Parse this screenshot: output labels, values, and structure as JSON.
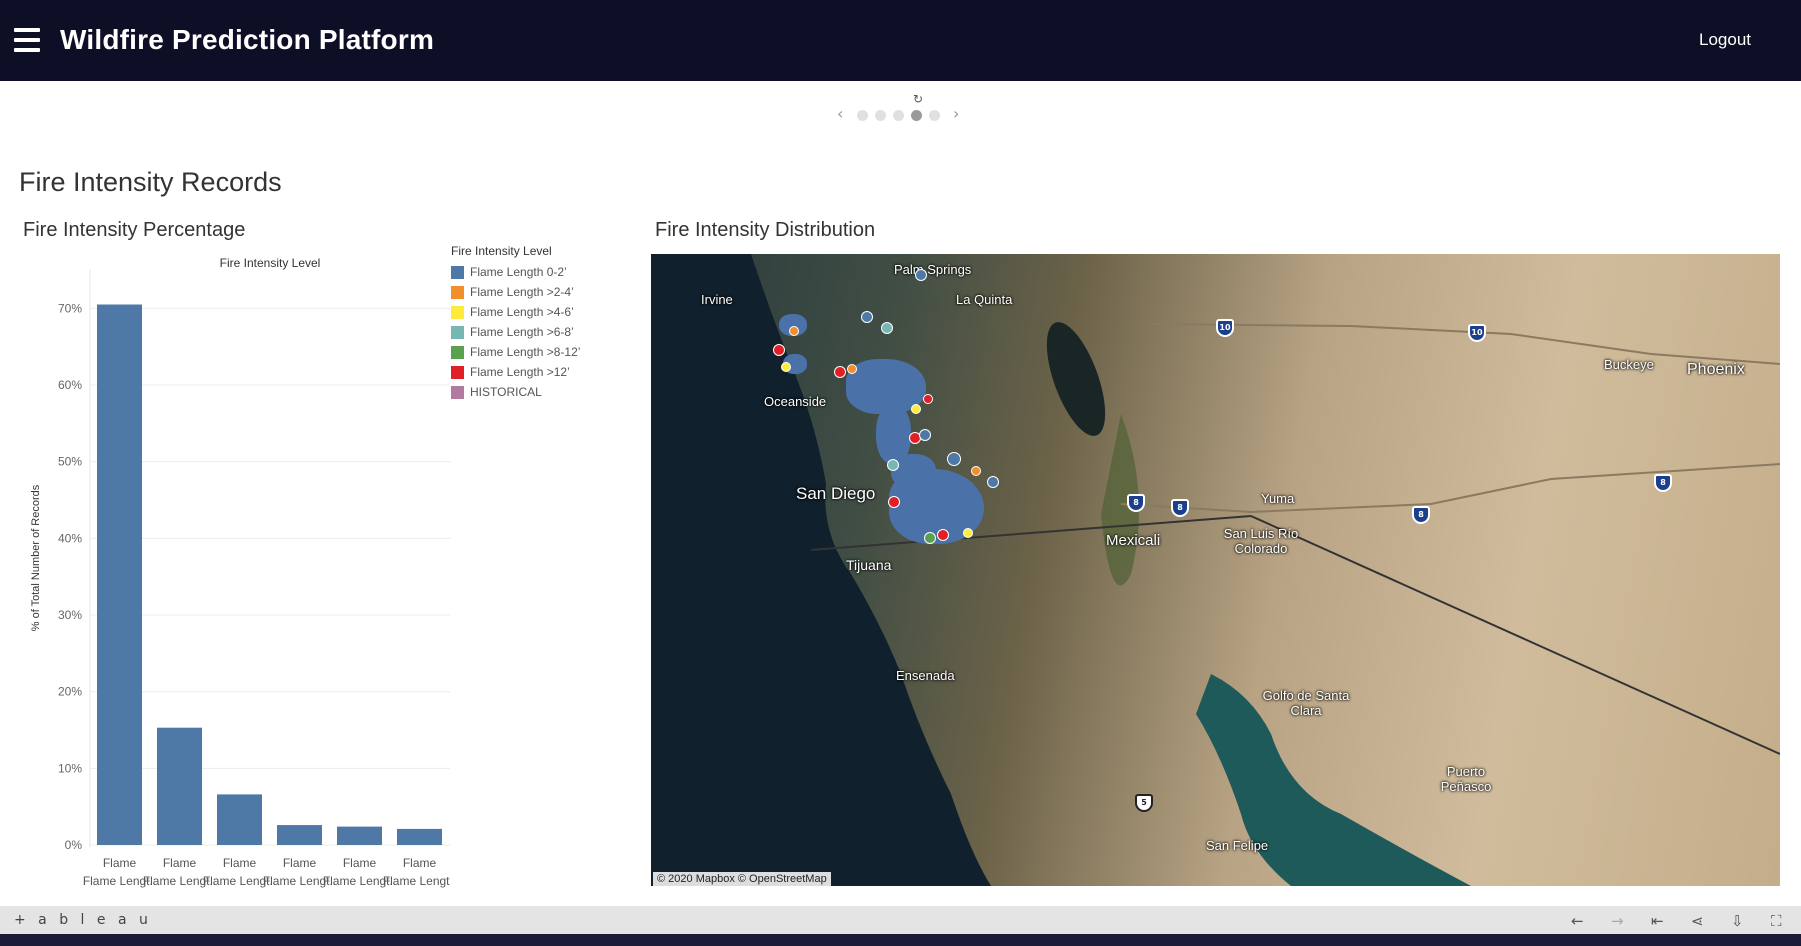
{
  "header": {
    "title": "Wildfire Prediction Platform",
    "logout_label": "Logout",
    "menu_icon": "hamburger-icon"
  },
  "carousel": {
    "prev": "‹",
    "next": "›",
    "refresh": "↻",
    "dots": 5,
    "active_index": 3
  },
  "dashboard": {
    "title": "Fire Intensity Records",
    "percentage_title": "Fire Intensity Percentage",
    "distribution_title": "Fire Intensity Distribution"
  },
  "legend": {
    "title": "Fire Intensity Level",
    "items": [
      {
        "label": "Flame Length 0-2’",
        "color": "#4e79a7"
      },
      {
        "label": "Flame Length >2-4’",
        "color": "#f28e2b"
      },
      {
        "label": "Flame Length >4-6’",
        "color": "#ffeb3b"
      },
      {
        "label": "Flame Length >6-8’",
        "color": "#76b7b2"
      },
      {
        "label": "Flame Length >8-12’",
        "color": "#59a14f"
      },
      {
        "label": "Flame Length >12’",
        "color": "#e01f26"
      },
      {
        "label": "HISTORICAL",
        "color": "#b07aa1"
      }
    ]
  },
  "chart_data": {
    "type": "bar",
    "title": "Fire Intensity Level",
    "ylabel": "% of Total Number of Records",
    "xlabel": "",
    "categories": [
      "Flame Lengt..",
      "Flame Lengt..",
      "Flame Lengt..",
      "Flame Lengt..",
      "Flame Lengt..",
      "Flame Lengt.."
    ],
    "category_line1": "Flame",
    "values": [
      70.5,
      15.3,
      6.6,
      2.6,
      2.4,
      2.1
    ],
    "yticks": [
      "0%",
      "10%",
      "20%",
      "30%",
      "40%",
      "50%",
      "60%",
      "70%"
    ],
    "ylim": [
      0,
      75
    ],
    "grid": true,
    "bar_color": "#4e79a7"
  },
  "map": {
    "labels": [
      "Palm Springs",
      "La Quinta",
      "Irvine",
      "Oceanside",
      "San Diego",
      "Tijuana",
      "Mexicali",
      "Yuma",
      "San Luis Río Colorado",
      "Ensenada",
      "Golfo de Santa Clara",
      "Puerto Peñasco",
      "San Felipe",
      "Buckeye",
      "Phoenix"
    ],
    "shields": [
      "10",
      "10",
      "8",
      "8",
      "8",
      "8",
      "5"
    ],
    "credit": "© 2020 Mapbox  © OpenStreetMap"
  },
  "footer": {
    "brand": "+ a b l e a u",
    "icons": [
      "undo-icon",
      "redo-icon",
      "revert-icon",
      "share-icon",
      "download-icon",
      "fullscreen-icon"
    ]
  }
}
